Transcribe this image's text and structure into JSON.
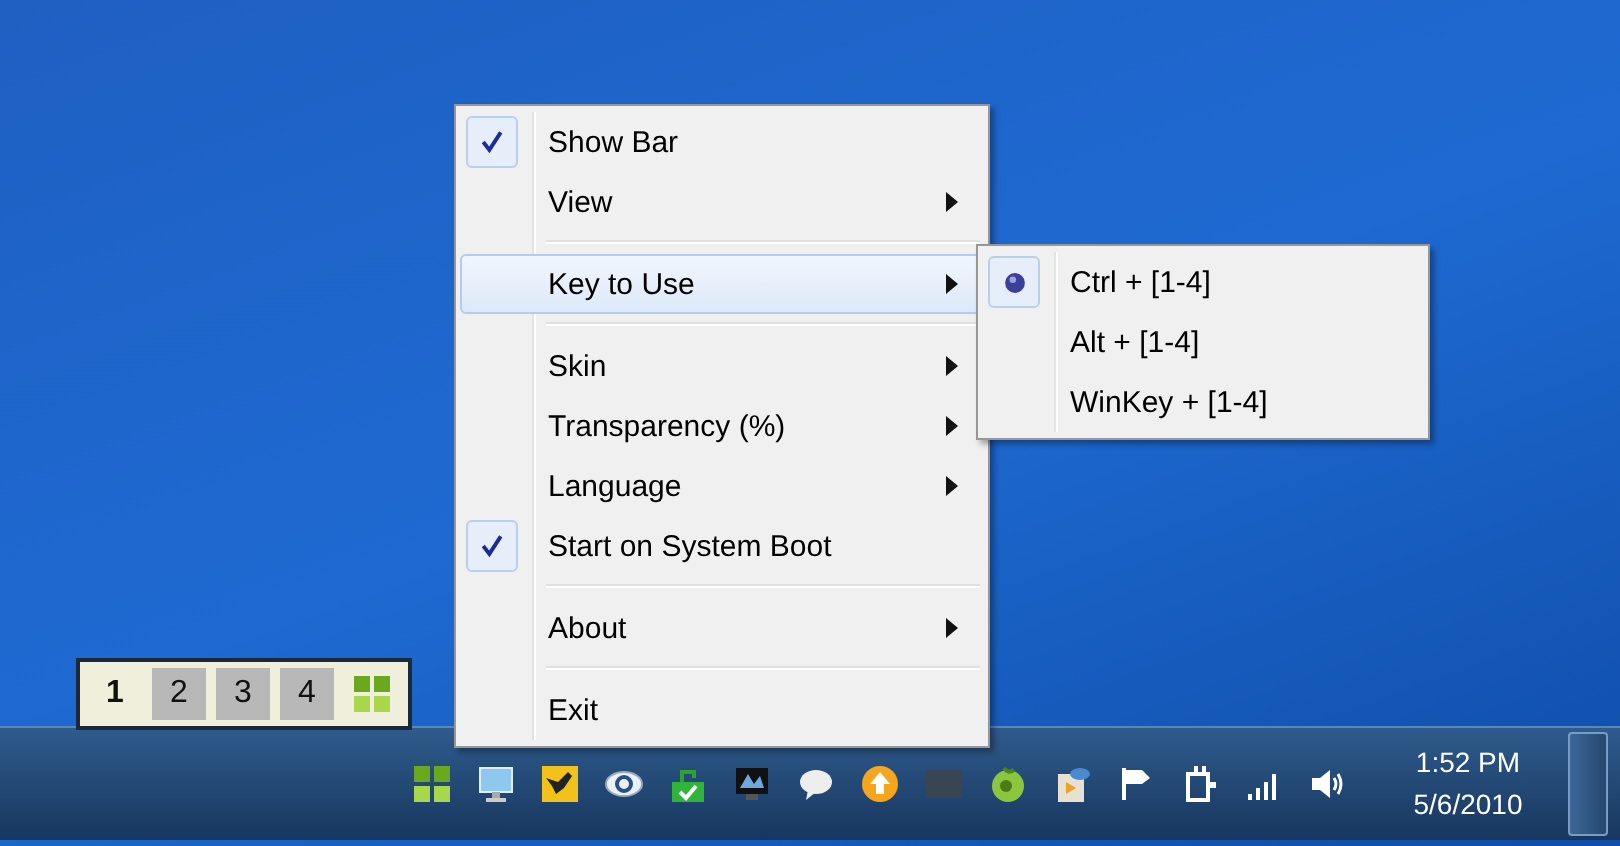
{
  "menu": {
    "items": [
      {
        "kind": "item",
        "label": "Show Bar",
        "checked": true,
        "submenu": false,
        "selected": false
      },
      {
        "kind": "item",
        "label": "View",
        "checked": false,
        "submenu": true,
        "selected": false
      },
      {
        "kind": "separator"
      },
      {
        "kind": "item",
        "label": "Key to Use",
        "checked": false,
        "submenu": true,
        "selected": true
      },
      {
        "kind": "separator"
      },
      {
        "kind": "item",
        "label": "Skin",
        "checked": false,
        "submenu": true,
        "selected": false
      },
      {
        "kind": "item",
        "label": "Transparency (%)",
        "checked": false,
        "submenu": true,
        "selected": false
      },
      {
        "kind": "item",
        "label": "Language",
        "checked": false,
        "submenu": true,
        "selected": false
      },
      {
        "kind": "item",
        "label": "Start on System Boot",
        "checked": true,
        "submenu": false,
        "selected": false
      },
      {
        "kind": "separator"
      },
      {
        "kind": "item",
        "label": "About",
        "checked": false,
        "submenu": true,
        "selected": false
      },
      {
        "kind": "separator"
      },
      {
        "kind": "item",
        "label": "Exit",
        "checked": false,
        "submenu": false,
        "selected": false
      }
    ]
  },
  "submenu": {
    "items": [
      {
        "label": "Ctrl + [1-4]",
        "selected": true
      },
      {
        "label": "Alt + [1-4]",
        "selected": false
      },
      {
        "label": "WinKey + [1-4]",
        "selected": false
      }
    ]
  },
  "desktop_switcher": {
    "buttons": [
      {
        "label": "1",
        "selected": true
      },
      {
        "label": "2",
        "selected": false
      },
      {
        "label": "3",
        "selected": false
      },
      {
        "label": "4",
        "selected": false
      }
    ]
  },
  "clock": {
    "time": "1:52 PM",
    "date": "5/6/2010"
  }
}
